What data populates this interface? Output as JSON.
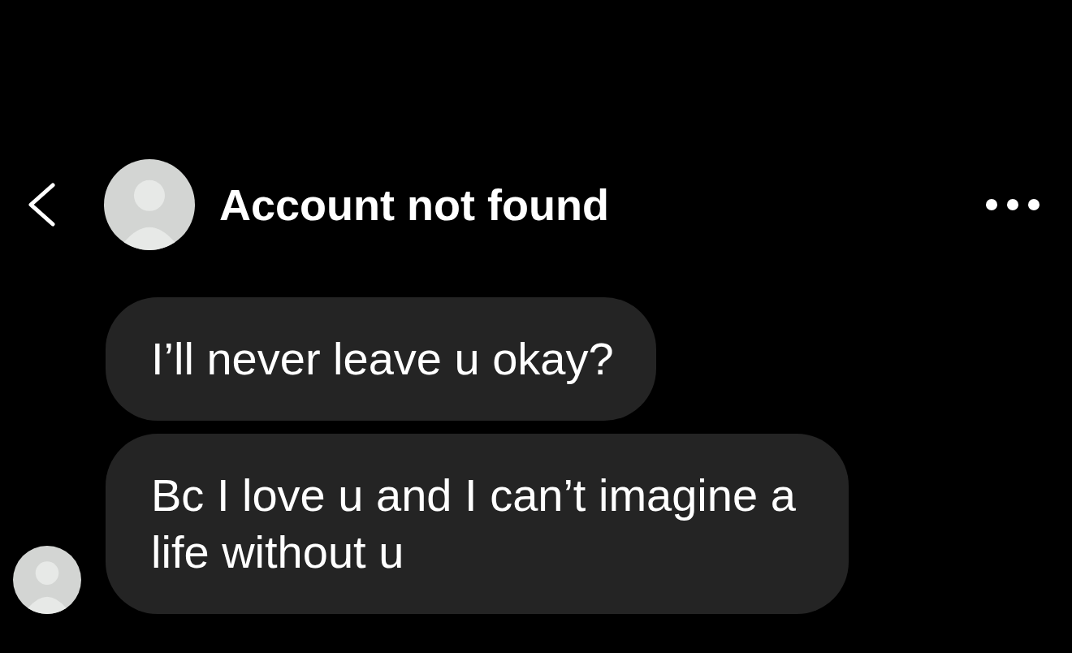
{
  "header": {
    "title": "Account not found"
  },
  "messages": [
    {
      "text": "I’ll never leave u okay?"
    },
    {
      "text": "Bc I love u and I can’t imagine a life without u"
    }
  ]
}
